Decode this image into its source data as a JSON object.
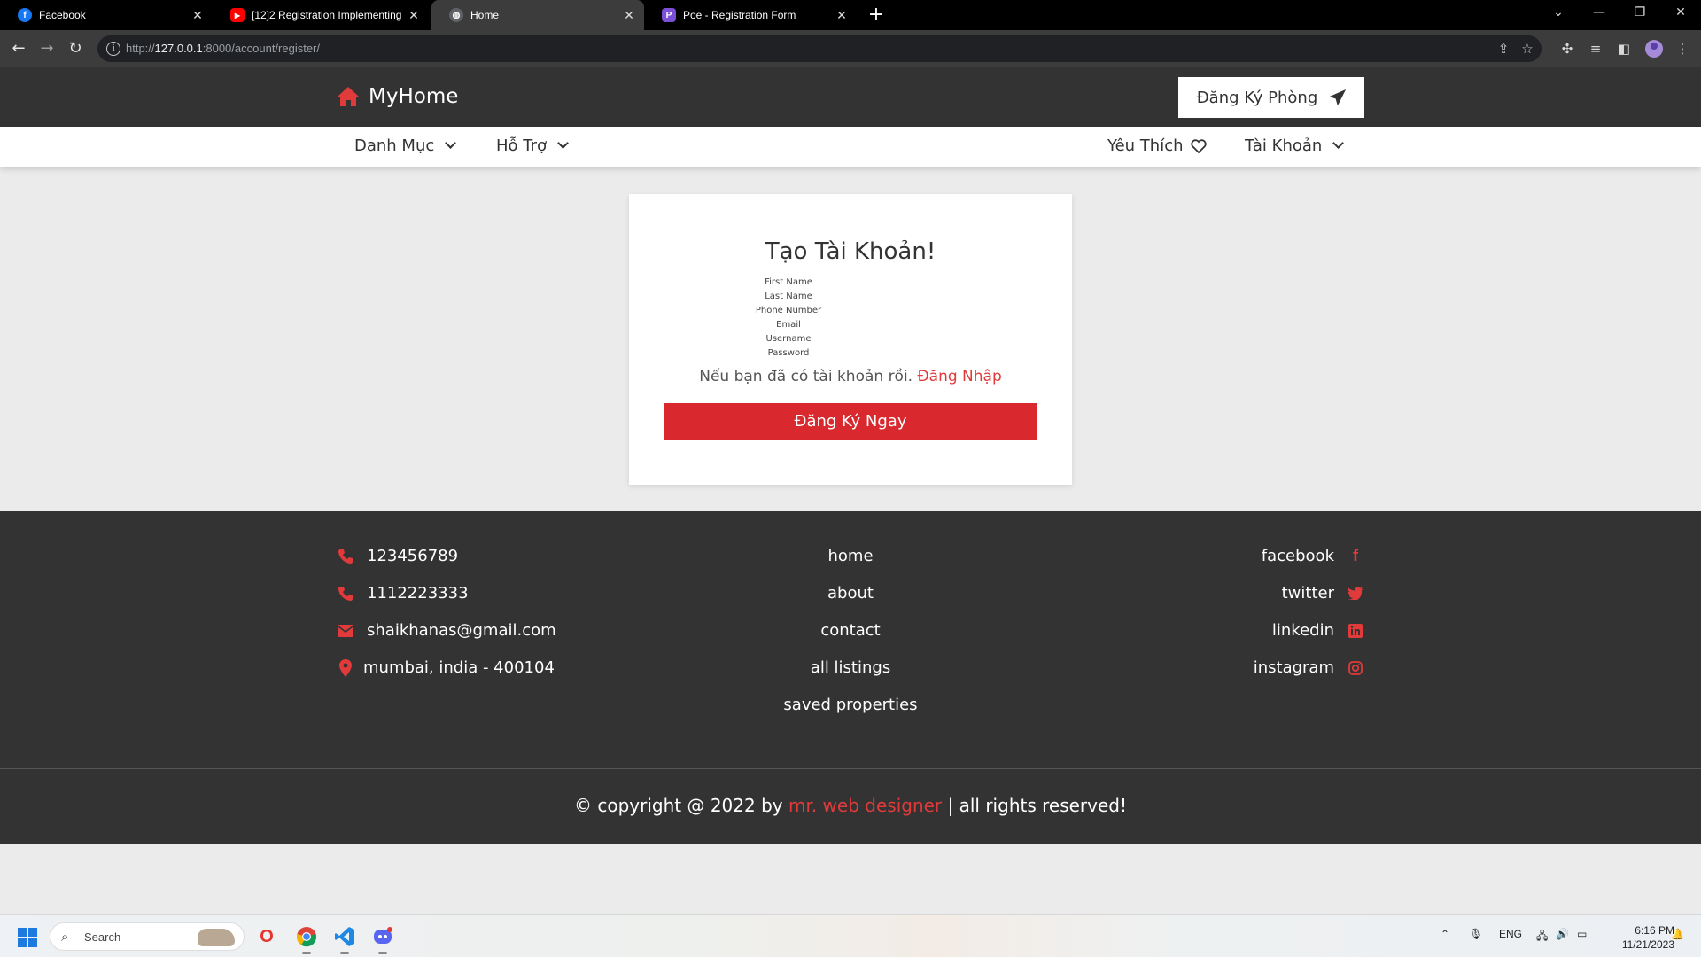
{
  "browser": {
    "tabs": [
      {
        "title": "Facebook",
        "favicon": "facebook-icon",
        "active": false
      },
      {
        "title": "[12]2 Registration Implementing",
        "favicon": "youtube-icon",
        "active": false
      },
      {
        "title": "Home",
        "favicon": "globe-icon",
        "active": true
      },
      {
        "title": "Poe - Registration Form",
        "favicon": "poe-icon",
        "active": false
      }
    ],
    "url_prefix": "http://",
    "url_host": "127.0.0.1",
    "url_rest": ":8000/account/register/"
  },
  "site": {
    "brand": "MyHome",
    "header_button": "Đăng Ký Phòng",
    "nav": {
      "categories": "Danh Mục",
      "support": "Hỗ Trợ",
      "favorites": "Yêu Thích",
      "account": "Tài Khoản"
    }
  },
  "register": {
    "title": "Tạo Tài Khoản!",
    "fields": [
      "First Name",
      "Last Name",
      "Phone Number",
      "Email",
      "Username",
      "Password"
    ],
    "login_prompt": "Nếu bạn đã có tài khoản rồi.",
    "login_link": "Đăng Nhập",
    "submit": "Đăng Ký Ngay"
  },
  "footer": {
    "contacts": [
      {
        "icon": "phone-icon",
        "text": "123456789"
      },
      {
        "icon": "phone-icon",
        "text": "1112223333"
      },
      {
        "icon": "envelope-icon",
        "text": "shaikhanas@gmail.com"
      },
      {
        "icon": "map-marker-icon",
        "text": "mumbai, india - 400104"
      }
    ],
    "links": [
      "home",
      "about",
      "contact",
      "all listings",
      "saved properties"
    ],
    "social": [
      {
        "icon": "facebook-icon",
        "text": "facebook"
      },
      {
        "icon": "twitter-icon",
        "text": "twitter"
      },
      {
        "icon": "linkedin-icon",
        "text": "linkedin"
      },
      {
        "icon": "instagram-icon",
        "text": "instagram"
      }
    ],
    "copyright_pre": "© copyright @ 2022 by",
    "copyright_author": "mr. web designer",
    "copyright_post": "| all rights reserved!"
  },
  "taskbar": {
    "search_placeholder": "Search",
    "language": "ENG",
    "time": "6:16 PM",
    "date": "11/21/2023"
  },
  "colors": {
    "accent": "#d9282e",
    "header_bg": "#333333",
    "page_bg": "#ebebeb"
  }
}
